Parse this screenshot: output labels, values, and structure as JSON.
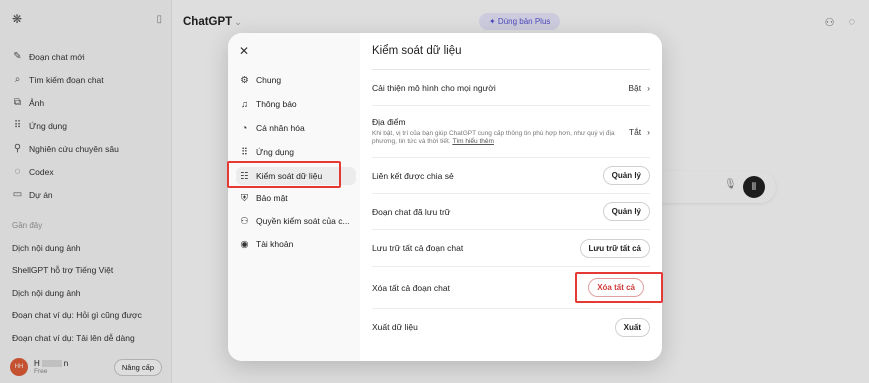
{
  "sidebar": {
    "items": [
      {
        "label": "Đoạn chat mới",
        "icon": "edit-icon"
      },
      {
        "label": "Tìm kiếm đoạn chat",
        "icon": "search-icon"
      },
      {
        "label": "Ảnh",
        "icon": "image-icon"
      },
      {
        "label": "Ứng dụng",
        "icon": "apps-icon"
      },
      {
        "label": "Nghiên cứu chuyên sâu",
        "icon": "telescope-icon"
      },
      {
        "label": "Codex",
        "icon": "codex-icon"
      },
      {
        "label": "Dự án",
        "icon": "folder-icon"
      }
    ],
    "section_label": "Gần đây",
    "chats": [
      "Dịch nội dung ảnh",
      "ShellGPT hỗ trợ Tiếng Việt",
      "Dịch nội dung ảnh",
      "Đoạn chat ví dụ: Hỏi gì cũng được",
      "Đoạn chat ví dụ: Tải lên dễ dàng"
    ],
    "user": {
      "initials": "HH",
      "name": "H",
      "name_suffix": "n",
      "plan": "Free",
      "upgrade_label": "Nâng cấp"
    }
  },
  "header": {
    "title": "ChatGPT",
    "title_chevron": "⌄",
    "plus_label": "✦ Dùng bản Plus"
  },
  "modal": {
    "close": "✕",
    "nav": [
      {
        "label": "Chung",
        "icon": "gear-icon"
      },
      {
        "label": "Thông báo",
        "icon": "bell-icon"
      },
      {
        "label": "Cá nhân hóa",
        "icon": "personalize-icon"
      },
      {
        "label": "Ứng dụng",
        "icon": "apps-icon"
      },
      {
        "label": "Kiểm soát dữ liệu",
        "icon": "database-icon",
        "active": true
      },
      {
        "label": "Bảo mật",
        "icon": "shield-icon"
      },
      {
        "label": "Quyền kiểm soát của c...",
        "icon": "parental-icon"
      },
      {
        "label": "Tài khoản",
        "icon": "account-icon"
      }
    ],
    "title": "Kiểm soát dữ liệu",
    "rows": {
      "improve": {
        "label": "Cải thiện mô hình cho mọi người",
        "value": "Bật"
      },
      "location": {
        "label": "Địa điểm",
        "desc": "Khi bật, vị trí của bạn giúp ChatGPT cung cấp thông tin phù hợp hơn, như quý vị địa phương, tin tức và thời tiết.",
        "link": "Tìm hiểu thêm",
        "value": "Tắt"
      },
      "shared_links": {
        "label": "Liên kết được chia sẻ",
        "button": "Quản lý"
      },
      "archived": {
        "label": "Đoạn chat đã lưu trữ",
        "button": "Quản lý"
      },
      "archive_all": {
        "label": "Lưu trữ tất cả đoạn chat",
        "button": "Lưu trữ tất cả"
      },
      "delete_all": {
        "label": "Xóa tất cả đoạn chat",
        "button": "Xóa tất cả"
      },
      "export": {
        "label": "Xuất dữ liệu",
        "button": "Xuất"
      }
    }
  },
  "colors": {
    "highlight": "#e53935",
    "danger_text": "#d23a3a",
    "plus_pill": "#ecebff"
  }
}
